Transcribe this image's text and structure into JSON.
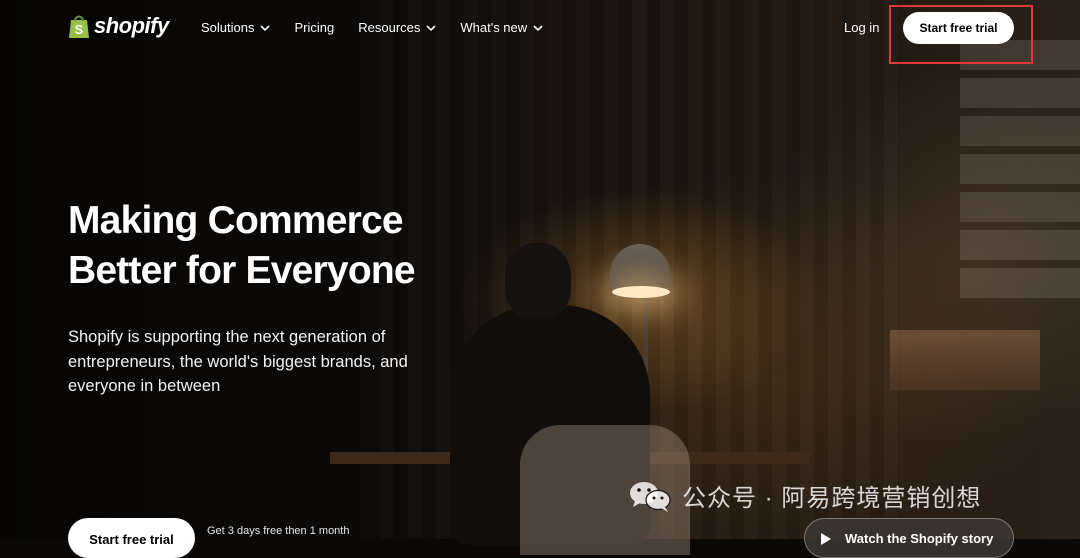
{
  "nav": {
    "logo_text": "shopify",
    "items": [
      {
        "label": "Solutions",
        "has_dropdown": true
      },
      {
        "label": "Pricing",
        "has_dropdown": false
      },
      {
        "label": "Resources",
        "has_dropdown": true
      },
      {
        "label": "What's new",
        "has_dropdown": true
      }
    ],
    "login_label": "Log in",
    "trial_label": "Start free trial"
  },
  "hero": {
    "title_line1": "Making Commerce",
    "title_line2": "Better for Everyone",
    "subtitle": "Shopify is supporting the next generation of entrepreneurs, the world's biggest brands, and everyone in between",
    "cta_label": "Start free trial",
    "cta_note": "Get 3 days free then 1 month",
    "watch_label": "Watch the Shopify story"
  },
  "watermark": {
    "text": "公众号 · 阿易跨境营销创想",
    "icon": "wechat-icon"
  },
  "colors": {
    "brand_green": "#95bf47",
    "highlight_red": "#e0383c",
    "button_bg": "#ffffff"
  }
}
